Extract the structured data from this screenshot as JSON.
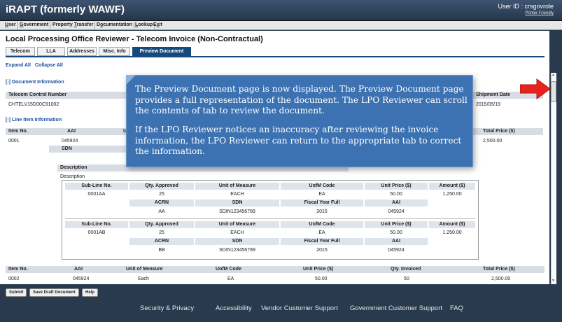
{
  "app": {
    "title": "iRAPT (formerly WAWF)",
    "user_id": "User ID : crsgovrole",
    "printer_friendly": "Printer Friendly"
  },
  "menu": [
    {
      "label": "User",
      "ul": "U",
      "rest": "ser"
    },
    {
      "label": "Government",
      "ul": "G",
      "rest": "overnment"
    },
    {
      "label": "Property Transfer",
      "pre": "Property ",
      "ul": "T",
      "rest": "ransfer"
    },
    {
      "label": "Documentation",
      "pre": "D",
      "ul": "o",
      "rest": "cumentation"
    },
    {
      "label": "Lookup",
      "ul": "L",
      "rest": "ookup"
    },
    {
      "label": "Exit",
      "pre": "E",
      "ul": "x",
      "rest": "it"
    }
  ],
  "page": {
    "title": "Local Processing Office Reviewer - Telecom Invoice (Non-Contractual)",
    "tabs": [
      "Telecom",
      "LLA",
      "Addresses",
      "Misc. Info",
      "Preview Document"
    ],
    "active_tab": "Preview Document",
    "expand_all": "Expand All",
    "collapse_all": "Collapse All"
  },
  "document_info": {
    "section": "[-] Document Information",
    "tcn_label": "Telecom Control Number",
    "tcn_value": "CHTELV15D00C91002",
    "shipment_date_label": "Shipment Date",
    "shipment_date_value": "2015/05/19"
  },
  "line_items": {
    "section": "[-] Line Item Information",
    "headers": {
      "item_no": "Item No.",
      "aai": "AAI",
      "total_price": "Total Price ($)",
      "unit_of_measure": "Unit of Measure",
      "ufom_code": "UofM Code",
      "unit_price": "Unit Price ($)",
      "qty_invoiced": "Qty. Invoiced"
    },
    "hidden_header_fragment": "U",
    "item1": {
      "item_no": "0001",
      "aai": "045924",
      "total_price": "2,500.00",
      "sdn_label": "SDN"
    },
    "description_label": "Description",
    "description_value": "Description",
    "item2": {
      "item_no": "0002",
      "aai": "045924",
      "unit_of_measure": "Each",
      "ufom_code": "EA",
      "unit_price": "50.00",
      "qty_invoiced": "50",
      "total_price": "2,500.00"
    }
  },
  "sub_lines": {
    "headers": {
      "sub_line": "Sub-Line No.",
      "qty_approved": "Qty. Approved",
      "unit_of_measure": "Unit of Measure",
      "ufom_code": "UofM Code",
      "unit_price": "Unit Price ($)",
      "amount": "Amount ($)",
      "acrn": "ACRN",
      "sdn": "SDN",
      "fiscal_year": "Fiscal Year Full",
      "aai": "AAI"
    },
    "rows": [
      {
        "sub_line": "0001AA",
        "qty_approved": "25",
        "unit_of_measure": "EACH",
        "ufom_code": "EA",
        "unit_price": "50.00",
        "amount": "1,250.00",
        "acrn": "AA",
        "sdn": "SDIN123456789",
        "fiscal_year": "2015",
        "aai": "045924"
      },
      {
        "sub_line": "0001AB",
        "qty_approved": "25",
        "unit_of_measure": "EACH",
        "ufom_code": "EA",
        "unit_price": "50.00",
        "amount": "1,250.00",
        "acrn": "BB",
        "sdn": "SDIN123456789",
        "fiscal_year": "2015",
        "aai": "045924"
      }
    ]
  },
  "buttons": {
    "submit": "Submit",
    "save_draft": "Save Draft Document",
    "help": "Help"
  },
  "footer": [
    "Security & Privacy",
    "Accessibility",
    "Vendor Customer Support",
    "Government Customer Support",
    "FAQ"
  ],
  "callout": {
    "p1": "The Preview Document page is now displayed. The Preview Document page provides a full representation of the document.  The LPO Reviewer can scroll the contents of tab to review the document.",
    "p2": "If the LPO Reviewer notices an inaccuracy after reviewing the invoice information, the LPO Reviewer can return to the appropriate tab to correct the information."
  },
  "colors": {
    "header": "#2a3a4e",
    "tab_active": "#174a7c",
    "callout": "#3c72b1",
    "arrow": "#e8231e"
  },
  "icons": {
    "pointer": "red-arrow-icon"
  }
}
